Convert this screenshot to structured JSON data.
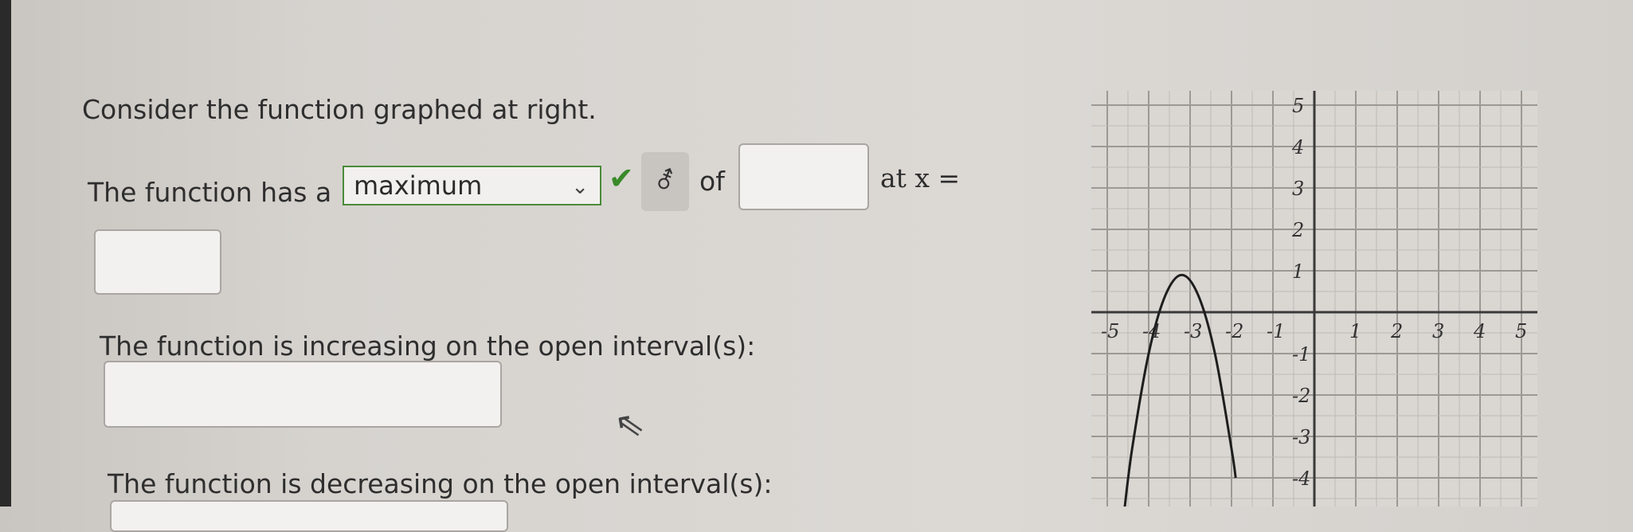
{
  "question": {
    "intro": "Consider the function graphed at right.",
    "line1_prefix": "The function has a",
    "extremum_select": {
      "selected": "maximum"
    },
    "line1_of": "of",
    "line1_suffix": "at x =",
    "increasing_label": "The function is increasing on the open interval(s):",
    "decreasing_label": "The function is decreasing on the open interval(s):"
  },
  "icons": {
    "check": "check-icon",
    "gender": "gender-symbol-icon",
    "dropdown": "chevron-down-icon"
  },
  "colors": {
    "check": "#3a8a2a",
    "select_border": "#4a8a3a"
  },
  "graph": {
    "x_ticks": [
      "-5",
      "-4",
      "-3",
      "-2",
      "-1",
      "1",
      "2",
      "3",
      "4",
      "5"
    ],
    "y_ticks": [
      "5",
      "4",
      "3",
      "2",
      "1",
      "-1",
      "-2",
      "-3",
      "-4"
    ]
  },
  "chart_data": {
    "type": "line",
    "title": "",
    "xlabel": "",
    "ylabel": "",
    "xlim": [
      -5,
      5
    ],
    "ylim": [
      -4.5,
      5
    ],
    "grid": true,
    "series": [
      {
        "x": [
          -4.6,
          -4.4,
          -4.0,
          -3.6,
          -3.2,
          -2.8,
          -2.4,
          -2.0,
          -1.9
        ],
        "y": [
          -4.9,
          -3.3,
          -1.0,
          0.4,
          0.9,
          0.4,
          -1.0,
          -3.3,
          -4.0
        ]
      }
    ]
  }
}
